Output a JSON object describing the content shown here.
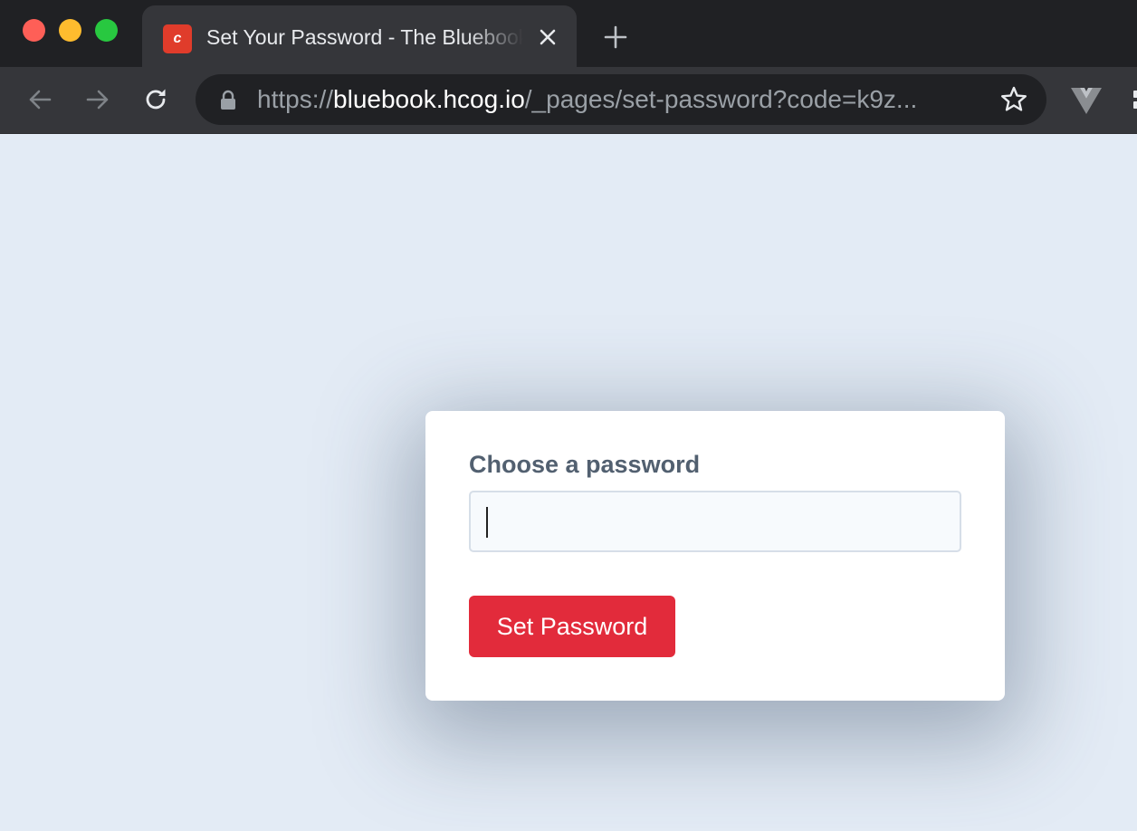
{
  "browser": {
    "tab": {
      "favicon_letter": "c",
      "favicon_color": "#e03c2b",
      "title": "Set Your Password - The Bluebook",
      "close_icon": "close-icon"
    },
    "new_tab_icon": "plus-icon",
    "nav": {
      "back_icon": "arrow-left-icon",
      "forward_icon": "arrow-right-icon",
      "reload_icon": "reload-icon"
    },
    "address": {
      "scheme": "https://",
      "host": "bluebook.hcog.io",
      "path": "/_pages/set-password?code=k9z...",
      "lock_icon": "lock-icon",
      "bookmark_icon": "star-icon"
    },
    "extensions": [
      "vue-devtools-icon",
      "puzzle-icon"
    ]
  },
  "form": {
    "label": "Choose a password",
    "password_value": "",
    "submit_label": "Set Password",
    "submit_color": "#e22b3b"
  },
  "colors": {
    "page_background": "#e3ebf5",
    "label_color": "#526070"
  }
}
